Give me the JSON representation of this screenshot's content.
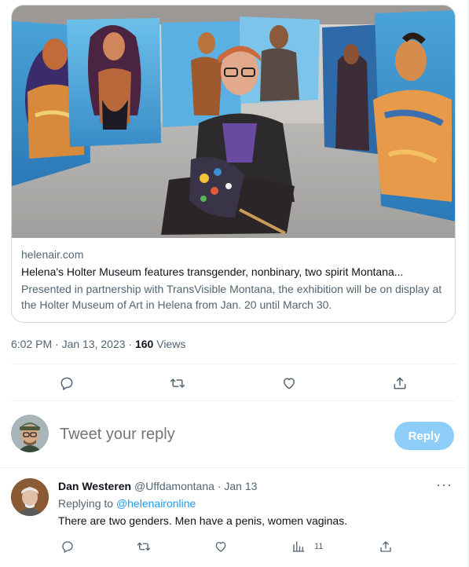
{
  "card": {
    "image_alt": "Artist seated with paint palette in front of large colorful portrait paintings",
    "domain": "helenair.com",
    "title": "Helena's Holter Museum features transgender, nonbinary, two spirit Montana...",
    "description": "Presented in partnership with TransVisible Montana, the exhibition will be on display at the Holter Museum of Art in Helena from Jan. 20 until March 30."
  },
  "meta": {
    "time": "6:02 PM · Jan 13, 2023 · ",
    "views_count": "160",
    "views_label": " Views"
  },
  "actions": [
    {
      "name": "reply",
      "icon": "reply-icon"
    },
    {
      "name": "retweet",
      "icon": "retweet-icon"
    },
    {
      "name": "like",
      "icon": "heart-icon"
    },
    {
      "name": "share",
      "icon": "share-icon"
    }
  ],
  "composer": {
    "placeholder": "Tweet your reply",
    "button_label": "Reply",
    "button_color": "#8ecdf8"
  },
  "reply_tweet": {
    "name": "Dan Westeren",
    "handle": "@Uffdamontana",
    "separator": " · ",
    "date": "Jan 13",
    "more_label": "···",
    "replying_prefix": "Replying to ",
    "replying_to": "@helenaironline",
    "text": "There are two genders. Men have a penis, women vaginas.",
    "views_count": "11"
  },
  "colors": {
    "accent": "#1d9bf0",
    "secondary_text": "#536471",
    "border": "#cfd9de"
  }
}
